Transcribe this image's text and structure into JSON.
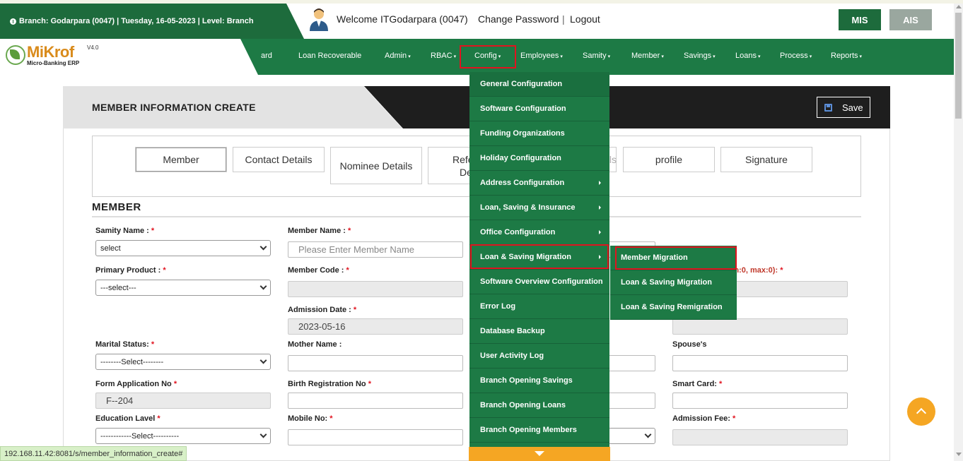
{
  "header": {
    "branch_info": "Branch: Godarpara (0047) | Tuesday, 16-05-2023 | Level: Branch",
    "welcome": "Welcome ITGodarpara (0047)",
    "change_password": "Change Password",
    "separator": "|",
    "logout": "Logout",
    "mis_label": "MIS",
    "ais_label": "AIS"
  },
  "logo": {
    "name": "MiKrof",
    "version": "V4.0",
    "subtitle": "Micro-Banking ERP"
  },
  "nav": {
    "items": [
      {
        "label": "ard",
        "caret": ""
      },
      {
        "label": "Loan Recoverable",
        "caret": ""
      },
      {
        "label": "Admin",
        "caret": "▾"
      },
      {
        "label": "RBAC",
        "caret": "▾"
      },
      {
        "label": "Config",
        "caret": "▾"
      },
      {
        "label": "Employees",
        "caret": "▾"
      },
      {
        "label": "Samity",
        "caret": "▾"
      },
      {
        "label": "Member",
        "caret": "▾"
      },
      {
        "label": "Savings",
        "caret": "▾"
      },
      {
        "label": "Loans",
        "caret": "▾"
      },
      {
        "label": "Process",
        "caret": "▾"
      },
      {
        "label": "Reports",
        "caret": "▾"
      }
    ]
  },
  "panel": {
    "title": "MEMBER INFORMATION CREATE",
    "save_label": "Save"
  },
  "tabs": [
    "Member",
    "Contact Details",
    "Nominee Details",
    "Reference Details",
    "Other Details",
    "profile",
    "Signature"
  ],
  "tab_fragments": {
    "reference_top": "Refe",
    "reference_bottom": "Details",
    "other": "er Details"
  },
  "section_title": "MEMBER",
  "form": {
    "samity_name_label": "Samity Name :",
    "samity_name_value": "select",
    "member_name_label": "Member Name :",
    "member_name_placeholder": "Please Enter Member Name",
    "primary_product_label": "Primary Product :",
    "primary_product_value": "---select---",
    "member_code_label": "Member Code :",
    "member_code_value": "",
    "dob_label": "Date Of Birth (min:0, max:0):",
    "admission_date_label": "Admission Date :",
    "admission_date_value": "2023-05-16",
    "marital_status_label": "Marital Status:",
    "marital_status_value": "--------Select--------",
    "mother_name_label": "Mother Name :",
    "spouse_label": "Spouse's",
    "form_app_label": "Form Application No",
    "form_app_value": "F--204",
    "birth_reg_label": "Birth Registration No",
    "smart_card_label": "Smart Card:",
    "education_label": "Education Lavel",
    "education_value": "------------Select----------",
    "mobile_label": "Mobile No:",
    "admission_fee_label": "Admission Fee:",
    "required_mark": "*"
  },
  "config_menu": {
    "items": [
      {
        "label": "General Configuration",
        "has_sub": false
      },
      {
        "label": "Software Configuration",
        "has_sub": false
      },
      {
        "label": "Funding Organizations",
        "has_sub": false
      },
      {
        "label": "Holiday Configuration",
        "has_sub": false
      },
      {
        "label": "Address Configuration",
        "has_sub": true
      },
      {
        "label": "Loan, Saving & Insurance",
        "has_sub": true
      },
      {
        "label": "Office Configuration",
        "has_sub": true
      },
      {
        "label": "Loan & Saving Migration",
        "has_sub": true
      },
      {
        "label": "Software Overview Configuration",
        "has_sub": false
      },
      {
        "label": "Error Log",
        "has_sub": false
      },
      {
        "label": "Database Backup",
        "has_sub": false
      },
      {
        "label": "User Activity Log",
        "has_sub": false
      },
      {
        "label": "Branch Opening Savings",
        "has_sub": false
      },
      {
        "label": "Branch Opening Loans",
        "has_sub": false
      },
      {
        "label": "Branch Opening Members",
        "has_sub": false
      }
    ]
  },
  "submenu": {
    "items": [
      "Member Migration",
      "Loan & Saving Migration",
      "Loan & Saving Remigration"
    ]
  },
  "status_url": "192.168.11.42:8081/s/member_information_create#",
  "colors": {
    "primary_green": "#1d7a45",
    "dark_green": "#1d6b3c",
    "accent_orange": "#f5a623",
    "highlight_red": "#e1131f"
  }
}
